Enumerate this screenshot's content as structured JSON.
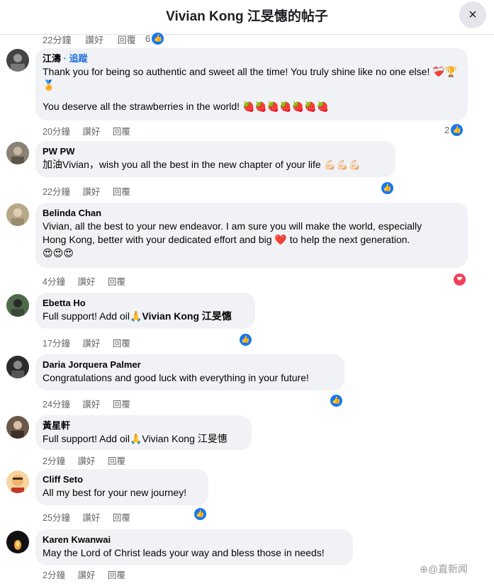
{
  "header": {
    "title": "Vivian Kong 江旻憓的帖子",
    "close_icon": "×"
  },
  "top_meta": {
    "time": "22分鐘",
    "like": "讚好",
    "reply": "回覆",
    "reaction_count": "6"
  },
  "comments": [
    {
      "author": "江濤",
      "follow": "· 追蹤",
      "lines": [
        "Thank you for being so authentic and sweet all the time! You truly shine like no one else! ❤️‍🩹🏆🏅",
        "You deserve all the strawberries in the world! 🍓🍓🍓🍓🍓🍓🍓"
      ],
      "time": "20分鐘",
      "like": "讚好",
      "reply": "回覆",
      "reaction_count": "2",
      "reaction": "like"
    },
    {
      "author": "PW PW",
      "lines": [
        "加油Vivian，wish you all the best in the new chapter of your life 💪🏻💪🏻💪🏻"
      ],
      "time": "22分鐘",
      "like": "讚好",
      "reply": "回覆",
      "reaction": "like"
    },
    {
      "author": "Belinda Chan",
      "lines": [
        "Vivian, all the best to your new endeavor. I am sure you will make the world, especially",
        "Hong Kong, better with your dedicated effort and big ❤️ to help the next generation.",
        "😍😍😍"
      ],
      "time": "4分鐘",
      "like": "讚好",
      "reply": "回覆",
      "reaction": "love"
    },
    {
      "author": "Ebetta Ho",
      "text_prefix": "Full support! Add oil🙏",
      "text_bold": "Vivian Kong 江旻憓",
      "time": "17分鐘",
      "like": "讚好",
      "reply": "回覆",
      "reaction": "like"
    },
    {
      "author": "Daria Jorquera Palmer",
      "lines": [
        "Congratulations and good luck with everything in your future!"
      ],
      "time": "24分鐘",
      "like": "讚好",
      "reply": "回覆",
      "reaction": "like"
    },
    {
      "author": "黃星軒",
      "lines": [
        "Full support! Add oil🙏Vivian Kong 江旻憓"
      ],
      "time": "2分鐘",
      "like": "讚好",
      "reply": "回覆"
    },
    {
      "author": "Cliff Seto",
      "lines": [
        "All my best for your new journey!"
      ],
      "time": "25分鐘",
      "like": "讚好",
      "reply": "回覆",
      "reaction": "like"
    },
    {
      "author": "Karen Kwanwai",
      "lines": [
        "May the Lord of Christ leads your way and bless those in needs!"
      ],
      "time": "2分鐘",
      "like": "讚好",
      "reply": "回覆"
    }
  ],
  "reaction_icons": {
    "like": "👍",
    "love": "❤"
  },
  "watermark": "⊕@直新闻",
  "colors": {
    "bubble": "#f0f2f5",
    "link": "#216fdb",
    "like": "#1877f2",
    "love": "#f33e58",
    "meta": "#65676b"
  }
}
